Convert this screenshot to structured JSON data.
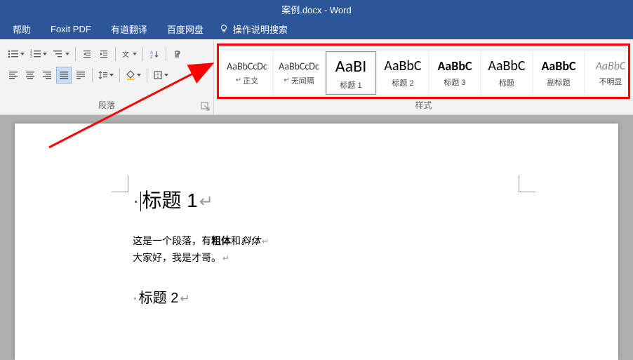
{
  "title": "案例.docx  -  Word",
  "menu": {
    "items": [
      "帮助",
      "Foxit PDF",
      "有道翻译",
      "百度网盘"
    ],
    "tell_me": "操作说明搜索"
  },
  "paragraph_group_label": "段落",
  "styles_group_label": "样式",
  "styles": [
    {
      "preview": "AaBbCcDc",
      "name": "正文",
      "size": "14px",
      "weight": "normal",
      "color": "#333",
      "pilcrow": true,
      "selected": false,
      "italic": false
    },
    {
      "preview": "AaBbCcDc",
      "name": "无间隔",
      "size": "14px",
      "weight": "normal",
      "color": "#333",
      "pilcrow": true,
      "selected": false,
      "italic": false
    },
    {
      "preview": "AaBI",
      "name": "标题 1",
      "size": "24px",
      "weight": "normal",
      "color": "#000",
      "pilcrow": false,
      "selected": true,
      "italic": false
    },
    {
      "preview": "AaBbC",
      "name": "标题 2",
      "size": "20px",
      "weight": "normal",
      "color": "#000",
      "pilcrow": false,
      "selected": false,
      "italic": false
    },
    {
      "preview": "AaBbC",
      "name": "标题 3",
      "size": "18px",
      "weight": "bold",
      "color": "#000",
      "pilcrow": false,
      "selected": false,
      "italic": false
    },
    {
      "preview": "AaBbC",
      "name": "标题",
      "size": "20px",
      "weight": "normal",
      "color": "#000",
      "pilcrow": false,
      "selected": false,
      "italic": false
    },
    {
      "preview": "AaBbC",
      "name": "副标题",
      "size": "18px",
      "weight": "bold",
      "color": "#000",
      "pilcrow": false,
      "selected": false,
      "italic": false
    },
    {
      "preview": "AaBbC",
      "name": "不明显",
      "size": "16px",
      "weight": "normal",
      "color": "#888",
      "pilcrow": false,
      "selected": false,
      "italic": true
    }
  ],
  "document": {
    "h1": "标题 1",
    "p1_a": "这是一个段落，有",
    "p1_bold": "粗体",
    "p1_b": "和",
    "p1_italic": "斜体",
    "p2": "大家好，我是才哥。",
    "h2": "标题 2"
  }
}
